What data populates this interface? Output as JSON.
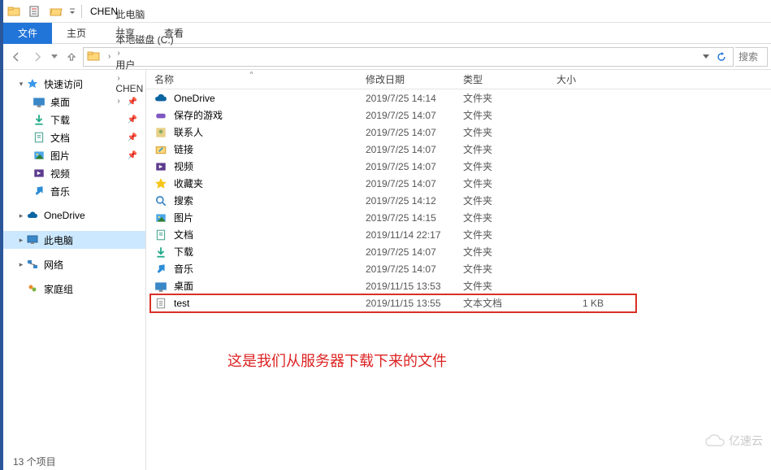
{
  "title": "CHEN",
  "ribbon": {
    "file": "文件",
    "home": "主页",
    "share": "共享",
    "view": "查看"
  },
  "breadcrumbs": [
    "此电脑",
    "本地磁盘 (C:)",
    "用户",
    "CHEN"
  ],
  "search_placeholder": "搜索",
  "sidebar": {
    "quick": {
      "label": "快速访问",
      "items": [
        {
          "label": "桌面",
          "icon": "desktop",
          "pinned": true
        },
        {
          "label": "下载",
          "icon": "download",
          "pinned": true
        },
        {
          "label": "文档",
          "icon": "doc",
          "pinned": true
        },
        {
          "label": "图片",
          "icon": "pic",
          "pinned": true
        },
        {
          "label": "视频",
          "icon": "video",
          "pinned": false
        },
        {
          "label": "音乐",
          "icon": "music",
          "pinned": false
        }
      ]
    },
    "onedrive": {
      "label": "OneDrive"
    },
    "thispc": {
      "label": "此电脑"
    },
    "network": {
      "label": "网络"
    },
    "homegroup": {
      "label": "家庭组"
    }
  },
  "columns": {
    "name": "名称",
    "date": "修改日期",
    "type": "类型",
    "size": "大小"
  },
  "files": [
    {
      "name": "OneDrive",
      "date": "2019/7/25 14:14",
      "type": "文件夹",
      "size": "",
      "icon": "cloud"
    },
    {
      "name": "保存的游戏",
      "date": "2019/7/25 14:07",
      "type": "文件夹",
      "size": "",
      "icon": "games"
    },
    {
      "name": "联系人",
      "date": "2019/7/25 14:07",
      "type": "文件夹",
      "size": "",
      "icon": "contacts"
    },
    {
      "name": "链接",
      "date": "2019/7/25 14:07",
      "type": "文件夹",
      "size": "",
      "icon": "links"
    },
    {
      "name": "视频",
      "date": "2019/7/25 14:07",
      "type": "文件夹",
      "size": "",
      "icon": "video"
    },
    {
      "name": "收藏夹",
      "date": "2019/7/25 14:07",
      "type": "文件夹",
      "size": "",
      "icon": "fav"
    },
    {
      "name": "搜索",
      "date": "2019/7/25 14:12",
      "type": "文件夹",
      "size": "",
      "icon": "search"
    },
    {
      "name": "图片",
      "date": "2019/7/25 14:15",
      "type": "文件夹",
      "size": "",
      "icon": "pic"
    },
    {
      "name": "文档",
      "date": "2019/11/14 22:17",
      "type": "文件夹",
      "size": "",
      "icon": "doc"
    },
    {
      "name": "下载",
      "date": "2019/7/25 14:07",
      "type": "文件夹",
      "size": "",
      "icon": "download"
    },
    {
      "name": "音乐",
      "date": "2019/7/25 14:07",
      "type": "文件夹",
      "size": "",
      "icon": "music"
    },
    {
      "name": "桌面",
      "date": "2019/11/15 13:53",
      "type": "文件夹",
      "size": "",
      "icon": "desktop"
    },
    {
      "name": "test",
      "date": "2019/11/15 13:55",
      "type": "文本文档",
      "size": "1 KB",
      "icon": "textfile"
    }
  ],
  "annotation": "这是我们从服务器下载下来的文件",
  "status": "13 个项目",
  "watermark": "亿速云"
}
